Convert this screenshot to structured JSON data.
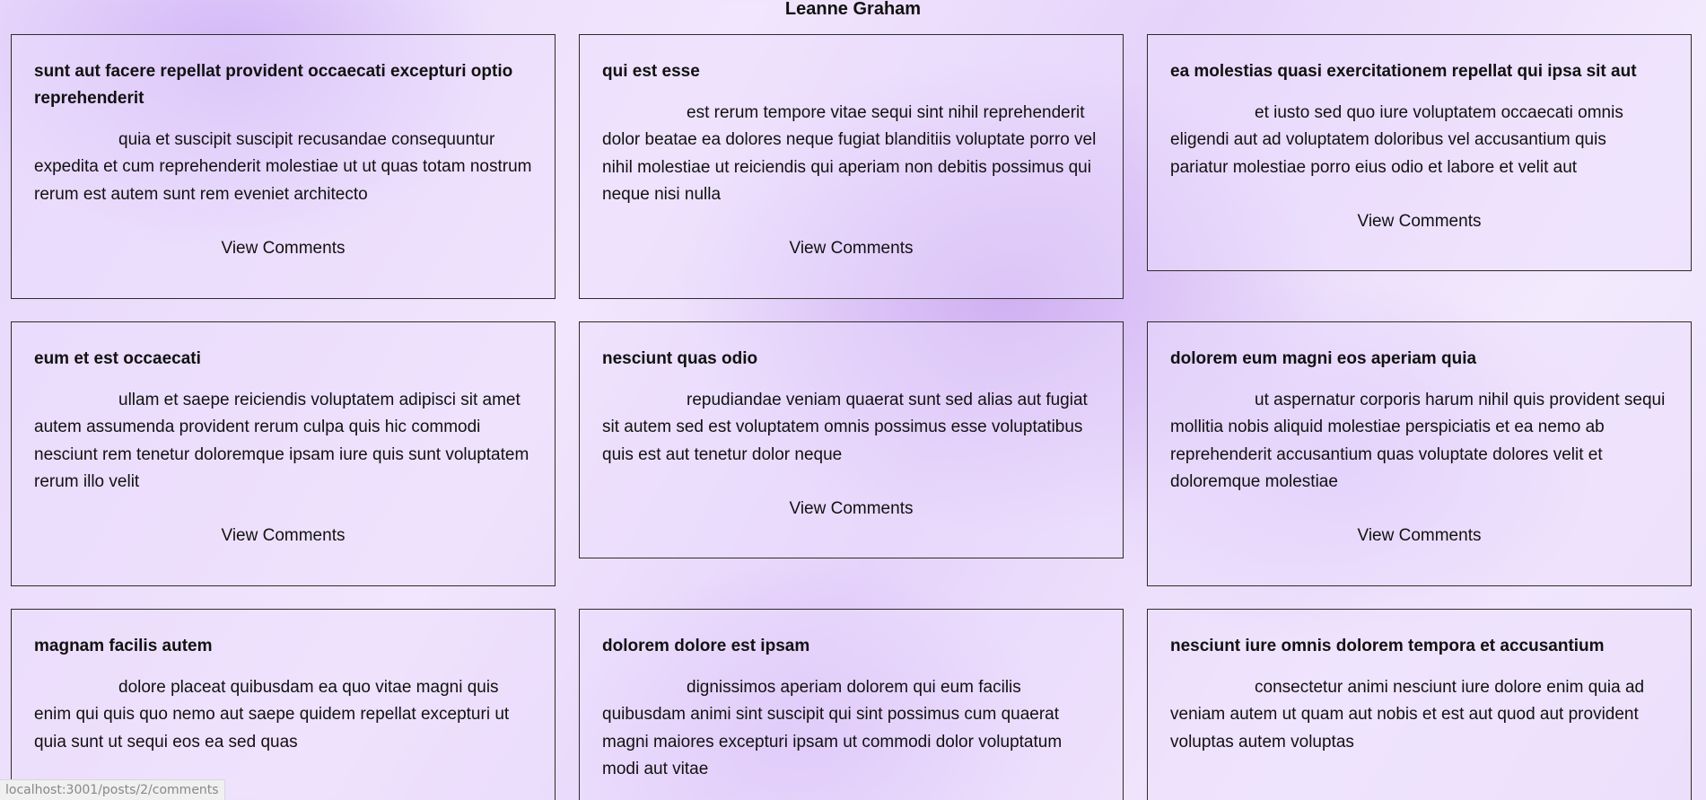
{
  "header": {
    "user_name": "Leanne Graham"
  },
  "posts": [
    {
      "title": "sunt aut facere repellat provident occaecati excepturi optio reprehenderit",
      "body": "quia et suscipit suscipit recusandae consequuntur expedita et cum reprehenderit molestiae ut ut quas totam nostrum rerum est autem sunt rem eveniet architecto",
      "link_label": "View Comments"
    },
    {
      "title": "qui est esse",
      "body": "est rerum tempore vitae sequi sint nihil reprehenderit dolor beatae ea dolores neque fugiat blanditiis voluptate porro vel nihil molestiae ut reiciendis qui aperiam non debitis possimus qui neque nisi nulla",
      "link_label": "View Comments"
    },
    {
      "title": "ea molestias quasi exercitationem repellat qui ipsa sit aut",
      "body": "et iusto sed quo iure voluptatem occaecati omnis eligendi aut ad voluptatem doloribus vel accusantium quis pariatur molestiae porro eius odio et labore et velit aut",
      "link_label": "View Comments"
    },
    {
      "title": "eum et est occaecati",
      "body": "ullam et saepe reiciendis voluptatem adipisci sit amet autem assumenda provident rerum culpa quis hic commodi nesciunt rem tenetur doloremque ipsam iure quis sunt voluptatem rerum illo velit",
      "link_label": "View Comments"
    },
    {
      "title": "nesciunt quas odio",
      "body": "repudiandae veniam quaerat sunt sed alias aut fugiat sit autem sed est voluptatem omnis possimus esse voluptatibus quis est aut tenetur dolor neque",
      "link_label": "View Comments"
    },
    {
      "title": "dolorem eum magni eos aperiam quia",
      "body": "ut aspernatur corporis harum nihil quis provident sequi mollitia nobis aliquid molestiae perspiciatis et ea nemo ab reprehenderit accusantium quas voluptate dolores velit et doloremque molestiae",
      "link_label": "View Comments"
    },
    {
      "title": "magnam facilis autem",
      "body": "dolore placeat quibusdam ea quo vitae magni quis enim qui quis quo nemo aut saepe quidem repellat excepturi ut quia sunt ut sequi eos ea sed quas"
    },
    {
      "title": "dolorem dolore est ipsam",
      "body": "dignissimos aperiam dolorem qui eum facilis quibusdam animi sint suscipit qui sint possimus cum quaerat magni maiores excepturi ipsam ut commodi dolor voluptatum modi aut vitae"
    },
    {
      "title": "nesciunt iure omnis dolorem tempora et accusantium",
      "body": "consectetur animi nesciunt iure dolore enim quia ad veniam autem ut quam aut nobis et est aut quod aut provident voluptas autem voluptas"
    }
  ],
  "status_bar": {
    "url": "localhost:3001/posts/2/comments"
  }
}
